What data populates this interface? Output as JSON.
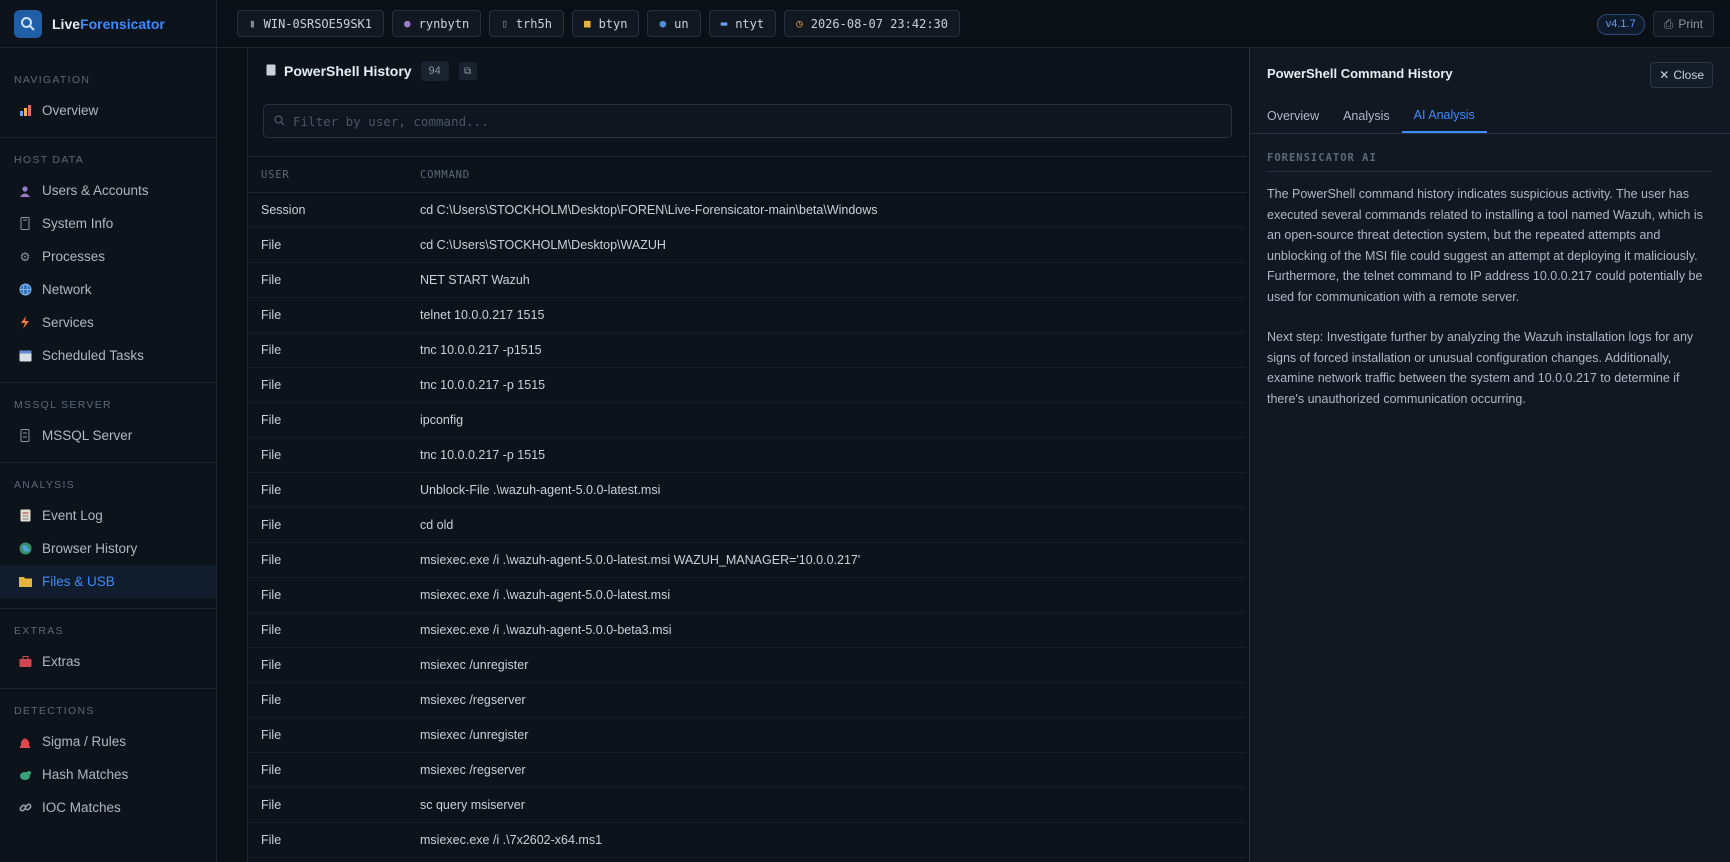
{
  "brand": {
    "name_part1": "Live",
    "name_part2": "Forensicator"
  },
  "sidebar": {
    "sections": [
      {
        "heading": "NAVIGATION",
        "items": [
          {
            "label": "Overview",
            "icon": "chart-icon"
          }
        ]
      },
      {
        "heading": "HOST DATA",
        "items": [
          {
            "label": "Users & Accounts",
            "icon": "user-icon"
          },
          {
            "label": "System Info",
            "icon": "computer-icon"
          },
          {
            "label": "Processes",
            "icon": "gear-icon"
          },
          {
            "label": "Network",
            "icon": "globe-icon"
          },
          {
            "label": "Services",
            "icon": "lightning-icon"
          },
          {
            "label": "Scheduled Tasks",
            "icon": "calendar-icon"
          }
        ]
      },
      {
        "heading": "MSSQL SERVER",
        "items": [
          {
            "label": "MSSQL Server",
            "icon": "database-icon"
          }
        ]
      },
      {
        "heading": "ANALYSIS",
        "items": [
          {
            "label": "Event Log",
            "icon": "log-icon"
          },
          {
            "label": "Browser History",
            "icon": "browser-globe-icon"
          },
          {
            "label": "Files & USB",
            "icon": "folder-icon",
            "active": true
          }
        ]
      },
      {
        "heading": "EXTRAS",
        "items": [
          {
            "label": "Extras",
            "icon": "toolbox-icon"
          }
        ]
      },
      {
        "heading": "DETECTIONS",
        "items": [
          {
            "label": "Sigma / Rules",
            "icon": "alarm-icon"
          },
          {
            "label": "Hash Matches",
            "icon": "hash-icon"
          },
          {
            "label": "IOC Matches",
            "icon": "link-icon"
          }
        ]
      }
    ]
  },
  "topbar": {
    "chips": [
      {
        "label": "WIN-0SRSOE59SK1",
        "icon": "computer-icon"
      },
      {
        "label": "rynbytn",
        "icon": "user-icon"
      },
      {
        "label": "trh5h",
        "icon": "document-icon"
      },
      {
        "label": "btyn",
        "icon": "folder-icon"
      },
      {
        "label": "un",
        "icon": "globe-icon"
      },
      {
        "label": "ntyt",
        "icon": "monitor-icon"
      },
      {
        "label": "2026-08-07 23:42:30",
        "icon": "clock-icon"
      }
    ],
    "version": "v4.1.7",
    "print_label": "Print"
  },
  "main": {
    "title": "PowerShell History",
    "count": "94",
    "filter_placeholder": "Filter by user, command...",
    "columns": {
      "user": "USER",
      "command": "COMMAND"
    },
    "rows": [
      {
        "user": "Session",
        "command": "cd C:\\Users\\STOCKHOLM\\Desktop\\FOREN\\Live-Forensicator-main\\beta\\Windows"
      },
      {
        "user": "File",
        "command": "cd C:\\Users\\STOCKHOLM\\Desktop\\WAZUH"
      },
      {
        "user": "File",
        "command": "NET START Wazuh"
      },
      {
        "user": "File",
        "command": "telnet 10.0.0.217 1515"
      },
      {
        "user": "File",
        "command": "tnc 10.0.0.217 -p1515"
      },
      {
        "user": "File",
        "command": "tnc 10.0.0.217 -p 1515"
      },
      {
        "user": "File",
        "command": "ipconfig"
      },
      {
        "user": "File",
        "command": "tnc 10.0.0.217 -p 1515"
      },
      {
        "user": "File",
        "command": "Unblock-File .\\wazuh-agent-5.0.0-latest.msi"
      },
      {
        "user": "File",
        "command": "cd old"
      },
      {
        "user": "File",
        "command": "msiexec.exe /i .\\wazuh-agent-5.0.0-latest.msi WAZUH_MANAGER='10.0.0.217'"
      },
      {
        "user": "File",
        "command": "msiexec.exe /i .\\wazuh-agent-5.0.0-latest.msi"
      },
      {
        "user": "File",
        "command": "msiexec.exe /i .\\wazuh-agent-5.0.0-beta3.msi"
      },
      {
        "user": "File",
        "command": "msiexec /unregister"
      },
      {
        "user": "File",
        "command": "msiexec /regserver"
      },
      {
        "user": "File",
        "command": "msiexec /unregister"
      },
      {
        "user": "File",
        "command": "msiexec /regserver"
      },
      {
        "user": "File",
        "command": "sc query msiserver"
      },
      {
        "user": "File",
        "command": "msiexec.exe /i .\\7x2602-x64.ms1"
      }
    ]
  },
  "details": {
    "title": "PowerShell Command History",
    "close_label": "Close",
    "tabs": [
      {
        "label": "Overview"
      },
      {
        "label": "Analysis"
      },
      {
        "label": "AI Analysis",
        "active": true
      }
    ],
    "ai_heading": "FORENSICATOR AI",
    "paragraphs": [
      "The PowerShell command history indicates suspicious activity. The user has executed several commands related to installing a tool named Wazuh, which is an open-source threat detection system, but the repeated attempts and unblocking of the MSI file could suggest an attempt at deploying it maliciously. Furthermore, the telnet command to IP address 10.0.0.217 could potentially be used for communication with a remote server.",
      "Next step: Investigate further by analyzing the Wazuh installation logs for any signs of forced installation or unusual configuration changes. Additionally, examine network traffic between the system and 10.0.0.217 to determine if there's unauthorized communication occurring."
    ]
  },
  "colors": {
    "accent": "#3b8cff",
    "background": "#0b1017",
    "panel": "#0d131b"
  }
}
